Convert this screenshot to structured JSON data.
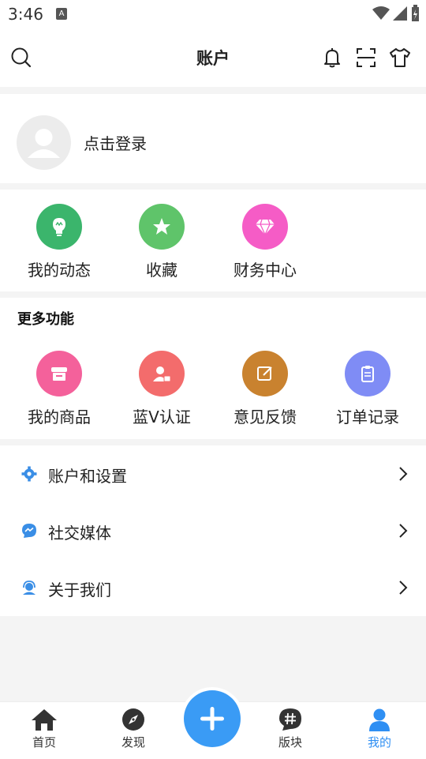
{
  "status_bar": {
    "time": "3:46",
    "badge": "A"
  },
  "header": {
    "title": "账户",
    "icons": [
      "search-icon",
      "bell-icon",
      "scan-icon",
      "tshirt-icon"
    ]
  },
  "login": {
    "label": "点击登录"
  },
  "quick_actions": [
    {
      "label": "我的动态",
      "icon": "lightbulb-icon",
      "color": "#3bb56c"
    },
    {
      "label": "收藏",
      "icon": "star-icon",
      "color": "#5fc46a"
    },
    {
      "label": "财务中心",
      "icon": "diamond-icon",
      "color": "#f55cc6"
    }
  ],
  "more_functions": {
    "title": "更多功能",
    "items": [
      {
        "label": "我的商品",
        "icon": "shop-icon",
        "color": "#f4619b"
      },
      {
        "label": "蓝V认证",
        "icon": "user-verify-icon",
        "color": "#f36c6c"
      },
      {
        "label": "意见反馈",
        "icon": "edit-icon",
        "color": "#c9822f"
      },
      {
        "label": "订单记录",
        "icon": "clipboard-icon",
        "color": "#7f8cf5"
      }
    ]
  },
  "menu": [
    {
      "label": "账户和设置",
      "icon": "gear-icon"
    },
    {
      "label": "社交媒体",
      "icon": "chat-bubble-icon"
    },
    {
      "label": "关于我们",
      "icon": "support-agent-icon"
    }
  ],
  "tabbar": {
    "items": [
      {
        "label": "首页",
        "icon": "home-icon"
      },
      {
        "label": "发现",
        "icon": "compass-icon"
      },
      {
        "label": "版块",
        "icon": "hash-icon"
      },
      {
        "label": "我的",
        "icon": "person-icon",
        "active": true
      }
    ],
    "fab_icon": "plus-icon",
    "accent": "#2f8ff3"
  }
}
